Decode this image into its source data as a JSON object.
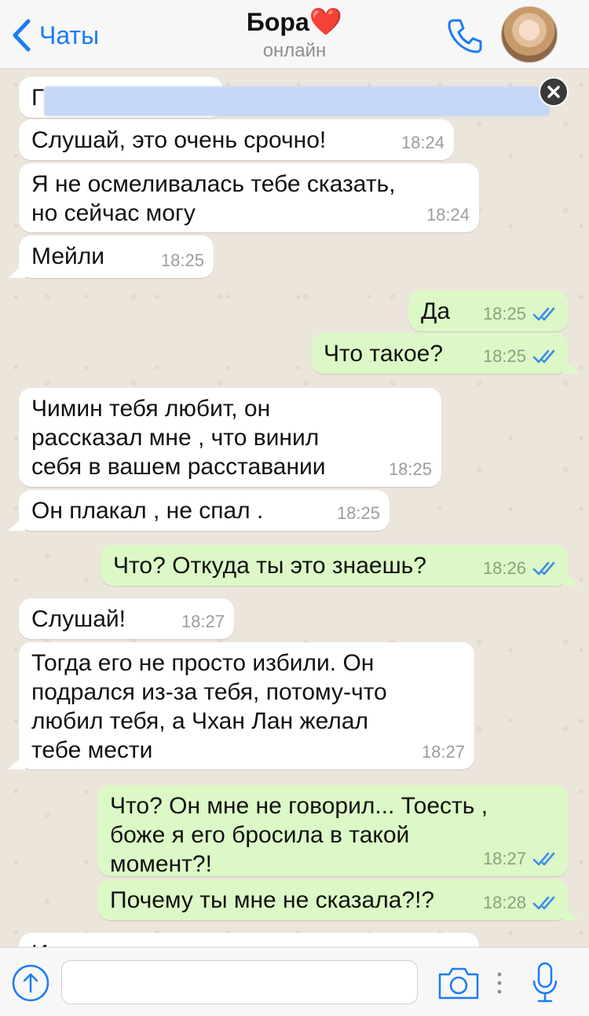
{
  "header": {
    "back_label": "Чаты",
    "contact_name": "Бора",
    "name_emoji": "❤️",
    "status": "онлайн"
  },
  "colors": {
    "accent": "#1a7cf6",
    "incoming_bubble": "#ffffff",
    "outgoing_bubble": "#dcf8c6",
    "read_ticks": "#3a8ee6",
    "chat_background": "#ece5dc"
  },
  "notice": {
    "visible_letter": "Г"
  },
  "messages": [
    {
      "dir": "in",
      "text": "Слушай, это очень срочно!",
      "time": "18:24"
    },
    {
      "dir": "in",
      "text": "Я не осмеливалась тебе сказать, но сейчас могу",
      "time": "18:24"
    },
    {
      "dir": "in",
      "text": "Мейли",
      "time": "18:25"
    },
    {
      "dir": "out",
      "text": "Да",
      "time": "18:25"
    },
    {
      "dir": "out",
      "text": "Что такое?",
      "time": "18:25"
    },
    {
      "dir": "in",
      "text": "Чимин тебя любит, он рассказал мне , что винил себя в вашем расставании",
      "time": "18:25"
    },
    {
      "dir": "in",
      "text": "Он плакал , не спал .",
      "time": "18:25"
    },
    {
      "dir": "out",
      "text": "Что? Откуда ты это знаешь?",
      "time": "18:26"
    },
    {
      "dir": "in",
      "text": "Слушай!",
      "time": "18:27"
    },
    {
      "dir": "in",
      "text": "Тогда его не просто избили. Он подрался из-за тебя, потому-что любил тебя, а Чхан Лан желал тебе мести",
      "time": "18:27"
    },
    {
      "dir": "out",
      "text": "Что? Он мне не говорил... Тоесть , боже я его бросила в такой момент?!",
      "time": "18:27"
    },
    {
      "dir": "out",
      "text": "Почему ты мне не сказала?!?",
      "time": "18:28"
    },
    {
      "dir": "in",
      "text": "И",
      "time": ""
    }
  ],
  "input": {
    "value": "",
    "placeholder": ""
  },
  "icons": {
    "back": "chevron-left-icon",
    "call": "phone-icon",
    "attach": "upload-arrow-icon",
    "camera": "camera-icon",
    "more": "vertical-dots-icon",
    "mic": "microphone-icon",
    "close": "close-icon",
    "read": "double-check-icon"
  }
}
